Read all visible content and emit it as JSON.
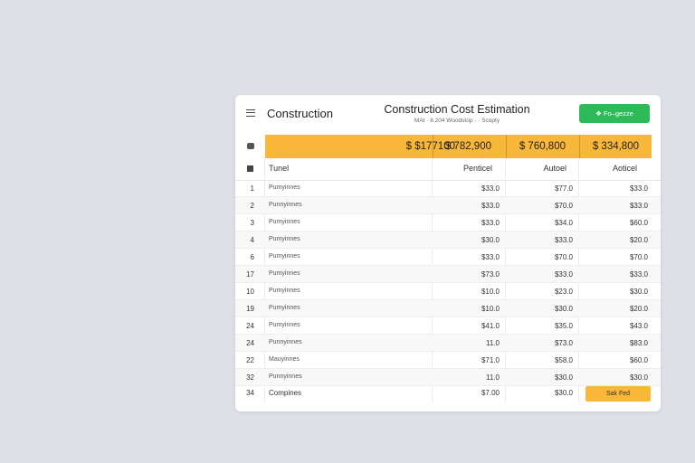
{
  "header": {
    "app_title": "Construction",
    "title": "Construction Cost Estimation",
    "subtitle": "MAI · 8.204 Woodstop · · Scopty",
    "action_button": "❖ Fo–gezze"
  },
  "totals": [
    "$ $177100",
    "$ 782,900",
    "$ 760,800",
    "$ 334,800"
  ],
  "columns": [
    "Tunel",
    "Penticel",
    "Autoel",
    "Aoticel"
  ],
  "rows": [
    {
      "n": "1",
      "name": "Pumyinnes",
      "a": "$33.0",
      "b": "$77.0",
      "c": "$33.0"
    },
    {
      "n": "2",
      "name": "Punnyinnes",
      "a": "$33.0",
      "b": "$70.0",
      "c": "$33.0"
    },
    {
      "n": "3",
      "name": "Pumyinnes",
      "a": "$33.0",
      "b": "$34.0",
      "c": "$60.0"
    },
    {
      "n": "4",
      "name": "Pumyinnes",
      "a": "$30.0",
      "b": "$33.0",
      "c": "$20.0"
    },
    {
      "n": "6",
      "name": "Pumyinnes",
      "a": "$33.0",
      "b": "$70.0",
      "c": "$70.0"
    },
    {
      "n": "17",
      "name": "Pumyinnes",
      "a": "$73.0",
      "b": "$33.0",
      "c": "$33.0"
    },
    {
      "n": "10",
      "name": "Pumyinnes",
      "a": "$10.0",
      "b": "$23.0",
      "c": "$30.0"
    },
    {
      "n": "19",
      "name": "Pumyinnes",
      "a": "$10.0",
      "b": "$30.0",
      "c": "$20.0"
    },
    {
      "n": "24",
      "name": "Pumyinnes",
      "a": "$41.0",
      "b": "$35.0",
      "c": "$43.0"
    },
    {
      "n": "24",
      "name": "Punnyinnes",
      "a": "11.0",
      "b": "$73.0",
      "c": "$83.0"
    },
    {
      "n": "22",
      "name": "Mauyinnes",
      "a": "$71.0",
      "b": "$58.0",
      "c": "$60.0"
    },
    {
      "n": "32",
      "name": "Punnyinnes",
      "a": "11.0",
      "b": "$30.0",
      "c": "$30.0"
    }
  ],
  "last_row": {
    "n": "34",
    "name": "Compines",
    "a": "$7.00",
    "b": "$30.0",
    "button": "Sak Fed"
  }
}
